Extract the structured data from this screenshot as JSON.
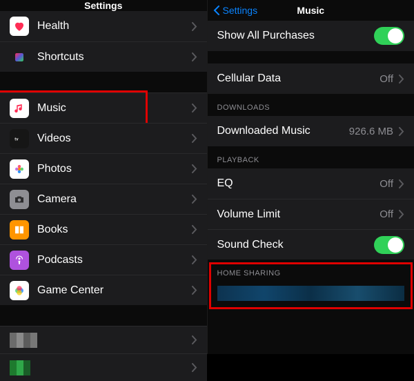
{
  "left": {
    "title": "Settings",
    "groups": [
      {
        "items": [
          {
            "label": "Health",
            "iconBg": "#ffffff",
            "iconFg": "#ff2d55",
            "glyph": "heart"
          },
          {
            "label": "Shortcuts",
            "iconBg": "#1c1c1e",
            "iconFg": "#ffffff",
            "glyph": "shortcut"
          }
        ]
      },
      {
        "items": [
          {
            "label": "Music",
            "iconBg": "#ffffff",
            "iconFg": "#ff2d55",
            "glyph": "music",
            "highlighted": true
          },
          {
            "label": "Videos",
            "iconBg": "#161616",
            "iconFg": "#dddddd",
            "glyph": "tv"
          },
          {
            "label": "Photos",
            "iconBg": "#ffffff",
            "iconFg": "#ffb300",
            "glyph": "photos"
          },
          {
            "label": "Camera",
            "iconBg": "#8e8e93",
            "iconFg": "#2c2c2e",
            "glyph": "camera"
          },
          {
            "label": "Books",
            "iconBg": "#ff9500",
            "iconFg": "#ffffff",
            "glyph": "book"
          },
          {
            "label": "Podcasts",
            "iconBg": "#af52de",
            "iconFg": "#ffffff",
            "glyph": "podcast"
          },
          {
            "label": "Game Center",
            "iconBg": "#ffffff",
            "iconFg": "#34c759",
            "glyph": "game"
          }
        ]
      }
    ]
  },
  "right": {
    "back": "Settings",
    "title": "Music",
    "sections": [
      {
        "header": "",
        "rows": [
          {
            "name": "show-all-purchases",
            "label": "Show All Purchases",
            "toggle": true
          }
        ]
      },
      {
        "header": "",
        "rows": [
          {
            "name": "cellular-data",
            "label": "Cellular Data",
            "value": "Off",
            "chevron": true
          }
        ]
      },
      {
        "header": "DOWNLOADS",
        "rows": [
          {
            "name": "downloaded-music",
            "label": "Downloaded Music",
            "value": "926.6 MB",
            "chevron": true
          }
        ]
      },
      {
        "header": "PLAYBACK",
        "rows": [
          {
            "name": "eq",
            "label": "EQ",
            "value": "Off",
            "chevron": true
          },
          {
            "name": "volume-limit",
            "label": "Volume Limit",
            "value": "Off",
            "chevron": true
          },
          {
            "name": "sound-check",
            "label": "Sound Check",
            "toggle": true
          }
        ]
      },
      {
        "header": "HOME SHARING",
        "highlighted": true,
        "rows": [
          {
            "name": "home-sharing-account",
            "blurred": true
          }
        ]
      }
    ]
  }
}
